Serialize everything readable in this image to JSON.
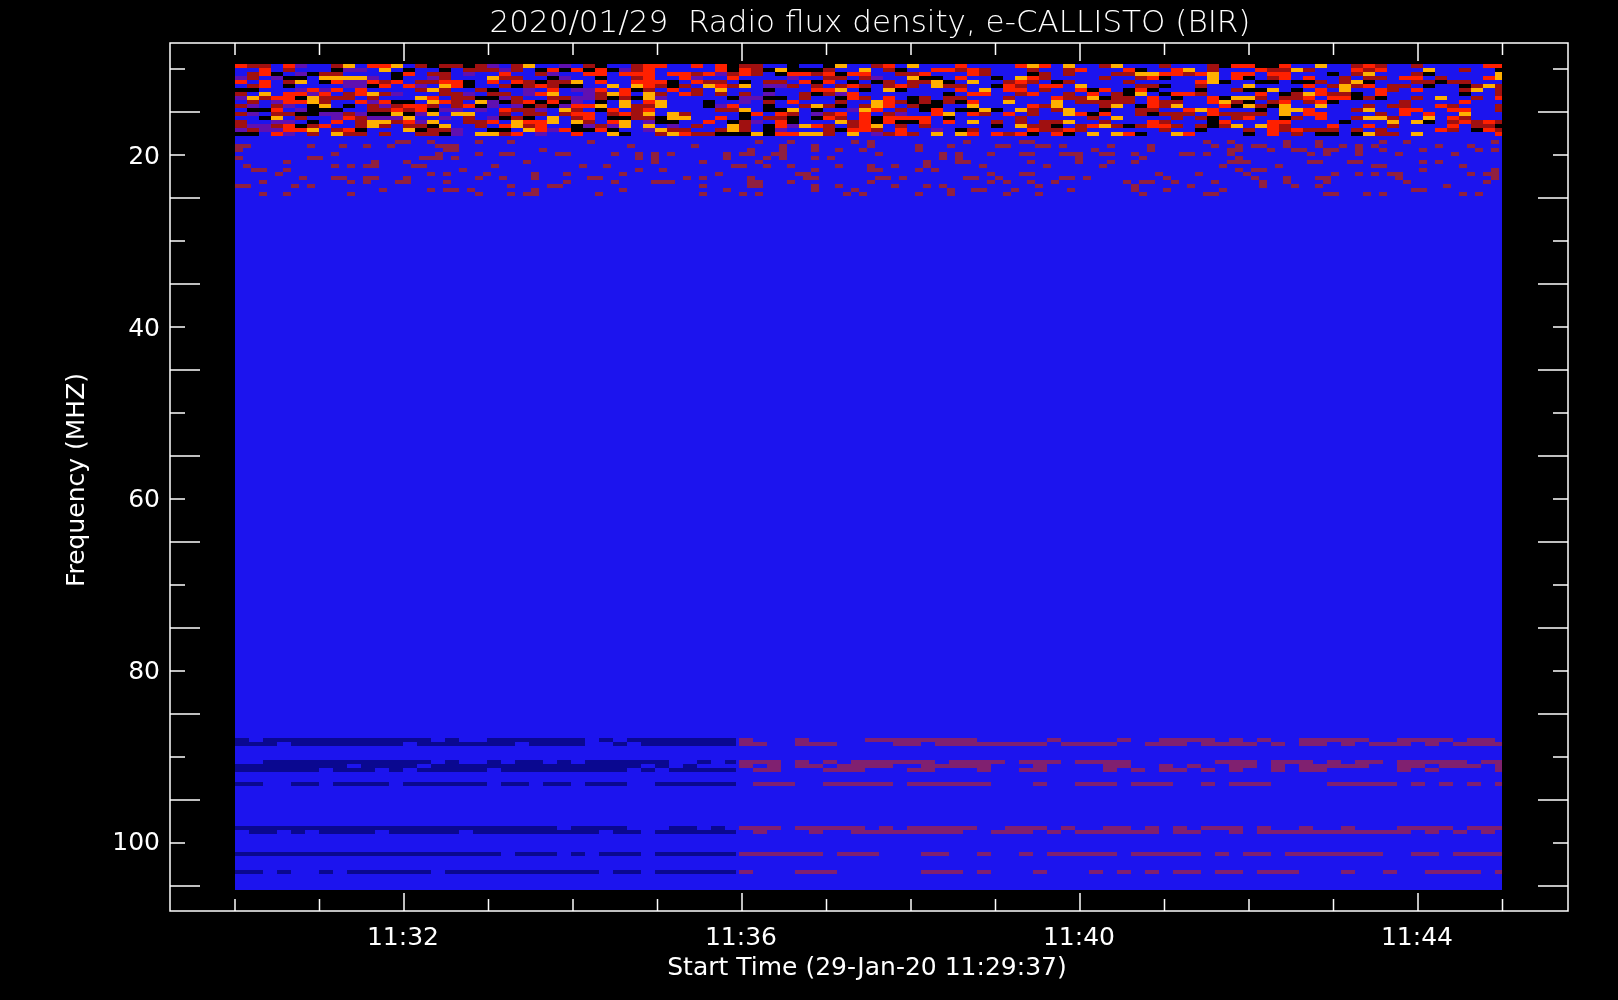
{
  "title": "2020/01/29  Radio flux density, e-CALLISTO (BIR)",
  "y_axis": {
    "label": "Frequency (MHZ)",
    "ticks": [
      "20",
      "40",
      "60",
      "80",
      "100"
    ]
  },
  "x_axis": {
    "label": "Start Time (29-Jan-20 11:29:37)",
    "ticks": [
      "11:32",
      "11:36",
      "11:40",
      "11:44"
    ]
  }
}
